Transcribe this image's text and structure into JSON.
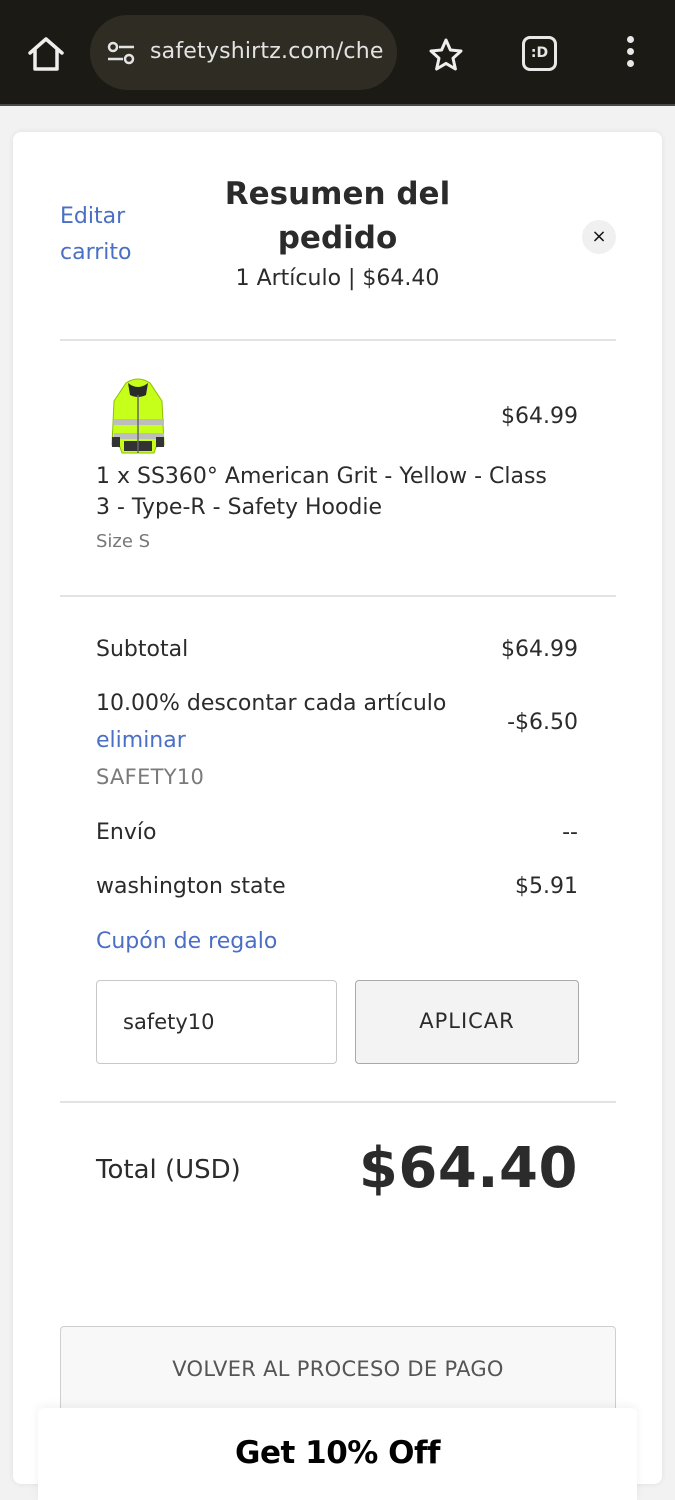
{
  "browser": {
    "url": "safetyshirtz.com/che",
    "tab_switcher_label": ":D"
  },
  "summary": {
    "edit_cart": "Editar carrito",
    "title": "Resumen del pedido",
    "subtitle": "1 Artículo | $64.40",
    "close": "×"
  },
  "product": {
    "image": "yellow-safety-hoodie",
    "price": "$64.99",
    "name": "1 x SS360° American Grit - Yellow - Class 3 - Type-R - Safety Hoodie",
    "size": "Size S"
  },
  "totals": {
    "subtotal_label": "Subtotal",
    "subtotal_value": "$64.99",
    "discount_label": "10.00% descontar cada artículo",
    "discount_remove": "eliminar",
    "discount_code": "SAFETY10",
    "discount_value": "-$6.50",
    "shipping_label": "Envío",
    "shipping_value": "--",
    "tax_label": "washington state",
    "tax_value": "$5.91"
  },
  "coupon": {
    "link": "Cupón de regalo",
    "input_value": "safety10",
    "apply_label": "APLICAR"
  },
  "total": {
    "label": "Total (USD)",
    "value": "$64.40"
  },
  "back_label": "VOLVER AL PROCESO DE PAGO",
  "promo_label": "Get 10% Off",
  "colors": {
    "link": "#4a6fc4",
    "topbar": "#1c1a14",
    "text": "#2b2b2b"
  }
}
